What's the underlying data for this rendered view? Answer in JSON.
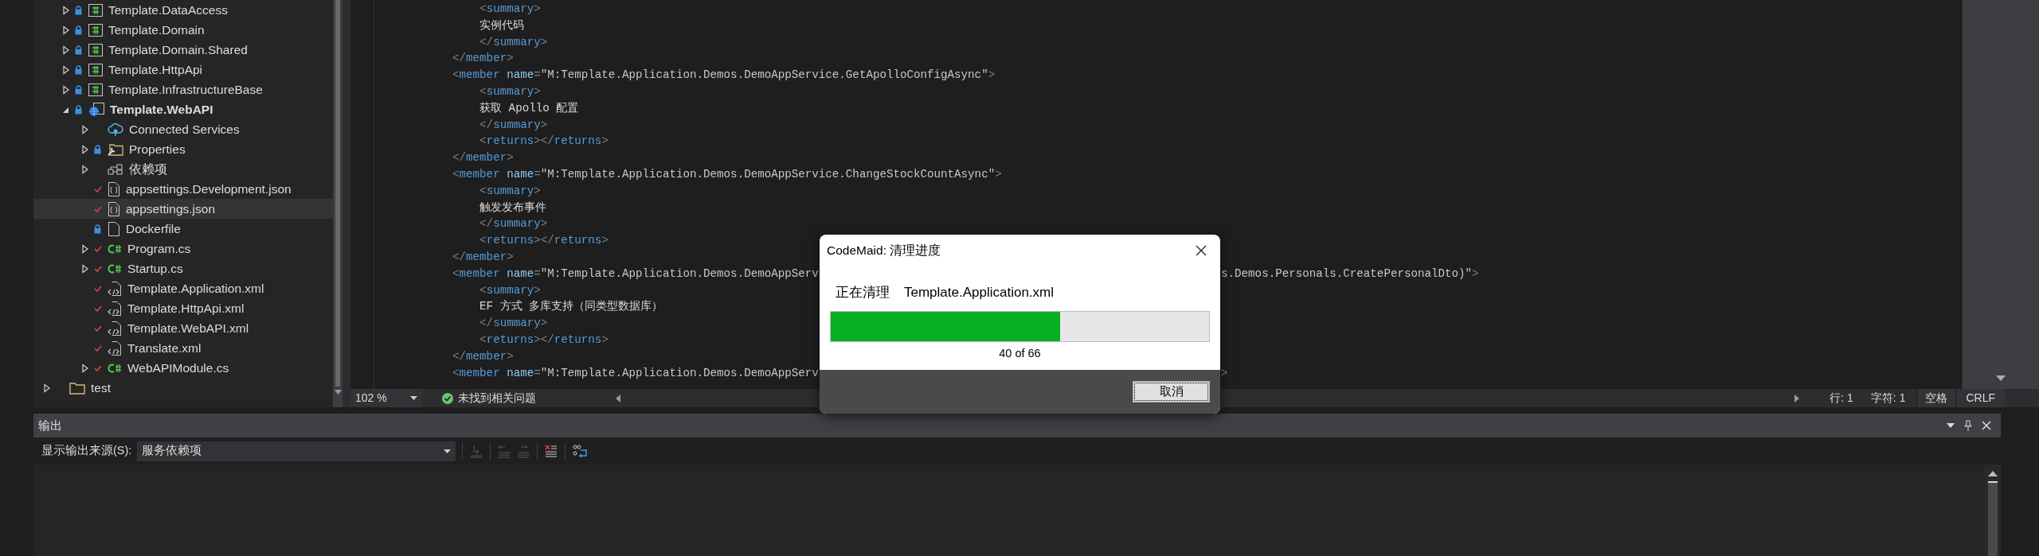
{
  "solution_explorer": {
    "projects": [
      {
        "kind": "csproj",
        "label": "Template.DataAccess",
        "expanded": false,
        "locked": true,
        "modified": false,
        "startup": false,
        "selected": false
      },
      {
        "kind": "csproj",
        "label": "Template.Domain",
        "expanded": false,
        "locked": true,
        "modified": false,
        "startup": false,
        "selected": false
      },
      {
        "kind": "csproj",
        "label": "Template.Domain.Shared",
        "expanded": false,
        "locked": true,
        "modified": false,
        "startup": false,
        "selected": false
      },
      {
        "kind": "csproj",
        "label": "Template.HttpApi",
        "expanded": false,
        "locked": true,
        "modified": false,
        "startup": false,
        "selected": false
      },
      {
        "kind": "csproj",
        "label": "Template.InfrastructureBase",
        "expanded": false,
        "locked": true,
        "modified": false,
        "startup": false,
        "selected": false
      },
      {
        "kind": "webproj",
        "label": "Template.WebAPI",
        "expanded": true,
        "locked": true,
        "modified": false,
        "startup": true,
        "selected": false,
        "children": [
          {
            "kind": "connected",
            "label": "Connected Services",
            "expanded": false,
            "locked": false,
            "modified": false,
            "startup": false,
            "selected": false
          },
          {
            "kind": "properties",
            "label": "Properties",
            "expanded": false,
            "locked": true,
            "modified": false,
            "startup": false,
            "selected": false
          },
          {
            "kind": "deps",
            "label": "依赖项",
            "expanded": false,
            "locked": false,
            "modified": false,
            "startup": false,
            "selected": false
          },
          {
            "kind": "json",
            "label": "appsettings.Development.json",
            "locked": false,
            "modified": true,
            "startup": false,
            "selected": false
          },
          {
            "kind": "json",
            "label": "appsettings.json",
            "locked": false,
            "modified": true,
            "startup": false,
            "selected": true
          },
          {
            "kind": "file",
            "label": "Dockerfile",
            "locked": true,
            "modified": false,
            "startup": false,
            "selected": false
          },
          {
            "kind": "cs",
            "label": "Program.cs",
            "expanded": false,
            "locked": false,
            "modified": true,
            "startup": false,
            "selected": false
          },
          {
            "kind": "cs",
            "label": "Startup.cs",
            "expanded": false,
            "locked": false,
            "modified": true,
            "startup": false,
            "selected": false
          },
          {
            "kind": "xml",
            "label": "Template.Application.xml",
            "locked": false,
            "modified": true,
            "startup": false,
            "selected": false
          },
          {
            "kind": "xml",
            "label": "Template.HttpApi.xml",
            "locked": false,
            "modified": true,
            "startup": false,
            "selected": false
          },
          {
            "kind": "xml",
            "label": "Template.WebAPI.xml",
            "locked": false,
            "modified": true,
            "startup": false,
            "selected": false
          },
          {
            "kind": "xml",
            "label": "Translate.xml",
            "locked": false,
            "modified": true,
            "startup": false,
            "selected": false
          },
          {
            "kind": "cs",
            "label": "WebAPIModule.cs",
            "expanded": false,
            "locked": false,
            "modified": true,
            "startup": false,
            "selected": false
          }
        ]
      }
    ],
    "root_items": [
      {
        "kind": "folder",
        "label": "test",
        "expanded": false,
        "locked": false,
        "modified": false,
        "startup": false,
        "selected": false
      }
    ]
  },
  "editor": {
    "lines": [
      {
        "kind": "inner",
        "tokens": [
          {
            "kind": "p",
            "text": "<"
          },
          {
            "kind": "tag",
            "text": "summary"
          },
          {
            "kind": "p",
            "text": ">"
          }
        ]
      },
      {
        "kind": "inner",
        "tokens": [
          {
            "kind": "text",
            "text": "实例代码"
          }
        ]
      },
      {
        "kind": "inner",
        "tokens": [
          {
            "kind": "p",
            "text": "</"
          },
          {
            "kind": "tag",
            "text": "summary"
          },
          {
            "kind": "p",
            "text": ">"
          }
        ]
      },
      {
        "kind": "member",
        "tokens": [
          {
            "kind": "p",
            "text": "</"
          },
          {
            "kind": "tag",
            "text": "member"
          },
          {
            "kind": "p",
            "text": ">"
          }
        ]
      },
      {
        "kind": "member",
        "tokens": [
          {
            "kind": "p",
            "text": "<"
          },
          {
            "kind": "tag",
            "text": "member"
          },
          {
            "kind": "attr",
            "text": "name"
          },
          {
            "kind": "p",
            "text": "="
          },
          {
            "kind": "str",
            "text": "\"M:Template.Application.Demos.DemoAppService.GetApolloConfigAsync\""
          },
          {
            "kind": "p",
            "text": ">"
          }
        ]
      },
      {
        "kind": "inner",
        "tokens": [
          {
            "kind": "p",
            "text": "<"
          },
          {
            "kind": "tag",
            "text": "summary"
          },
          {
            "kind": "p",
            "text": ">"
          }
        ]
      },
      {
        "kind": "inner",
        "tokens": [
          {
            "kind": "text",
            "text": "获取 Apollo 配置"
          }
        ]
      },
      {
        "kind": "inner",
        "tokens": [
          {
            "kind": "p",
            "text": "</"
          },
          {
            "kind": "tag",
            "text": "summary"
          },
          {
            "kind": "p",
            "text": ">"
          }
        ]
      },
      {
        "kind": "inner",
        "tokens": [
          {
            "kind": "p",
            "text": "<"
          },
          {
            "kind": "tag",
            "text": "returns"
          },
          {
            "kind": "p",
            "text": "></"
          },
          {
            "kind": "tag",
            "text": "returns"
          },
          {
            "kind": "p",
            "text": ">"
          }
        ]
      },
      {
        "kind": "member",
        "tokens": [
          {
            "kind": "p",
            "text": "</"
          },
          {
            "kind": "tag",
            "text": "member"
          },
          {
            "kind": "p",
            "text": ">"
          }
        ]
      },
      {
        "kind": "member",
        "tokens": [
          {
            "kind": "p",
            "text": "<"
          },
          {
            "kind": "tag",
            "text": "member"
          },
          {
            "kind": "attr",
            "text": "name"
          },
          {
            "kind": "p",
            "text": "="
          },
          {
            "kind": "str",
            "text": "\"M:Template.Application.Demos.DemoAppService.ChangeStockCountAsync\""
          },
          {
            "kind": "p",
            "text": ">"
          }
        ]
      },
      {
        "kind": "inner",
        "tokens": [
          {
            "kind": "p",
            "text": "<"
          },
          {
            "kind": "tag",
            "text": "summary"
          },
          {
            "kind": "p",
            "text": ">"
          }
        ]
      },
      {
        "kind": "inner",
        "tokens": [
          {
            "kind": "text",
            "text": "触发发布事件"
          }
        ]
      },
      {
        "kind": "inner",
        "tokens": [
          {
            "kind": "p",
            "text": "</"
          },
          {
            "kind": "tag",
            "text": "summary"
          },
          {
            "kind": "p",
            "text": ">"
          }
        ]
      },
      {
        "kind": "inner",
        "tokens": [
          {
            "kind": "p",
            "text": "<"
          },
          {
            "kind": "tag",
            "text": "returns"
          },
          {
            "kind": "p",
            "text": "></"
          },
          {
            "kind": "tag",
            "text": "returns"
          },
          {
            "kind": "p",
            "text": ">"
          }
        ]
      },
      {
        "kind": "member",
        "tokens": [
          {
            "kind": "p",
            "text": "</"
          },
          {
            "kind": "tag",
            "text": "member"
          },
          {
            "kind": "p",
            "text": ">"
          }
        ]
      },
      {
        "kind": "member",
        "tokens": [
          {
            "kind": "p",
            "text": "<"
          },
          {
            "kind": "tag",
            "text": "member"
          },
          {
            "kind": "attr",
            "text": "name"
          },
          {
            "kind": "p",
            "text": "="
          },
          {
            "kind": "str",
            "text": "\"M:Template.Application.Demos.DemoAppServ"
          }
        ],
        "right": [
          {
            "kind": "str",
            "text": "s.Demos.Personals.CreatePersonalDto)\""
          },
          {
            "kind": "p",
            "text": ">"
          }
        ]
      },
      {
        "kind": "inner",
        "tokens": [
          {
            "kind": "p",
            "text": "<"
          },
          {
            "kind": "tag",
            "text": "summary"
          },
          {
            "kind": "p",
            "text": ">"
          }
        ]
      },
      {
        "kind": "inner",
        "tokens": [
          {
            "kind": "text",
            "text": "EF 方式 多库支持（同类型数据库）"
          }
        ]
      },
      {
        "kind": "inner",
        "tokens": [
          {
            "kind": "p",
            "text": "</"
          },
          {
            "kind": "tag",
            "text": "summary"
          },
          {
            "kind": "p",
            "text": ">"
          }
        ]
      },
      {
        "kind": "inner",
        "tokens": [
          {
            "kind": "p",
            "text": "<"
          },
          {
            "kind": "tag",
            "text": "returns"
          },
          {
            "kind": "p",
            "text": "></"
          },
          {
            "kind": "tag",
            "text": "returns"
          },
          {
            "kind": "p",
            "text": ">"
          }
        ]
      },
      {
        "kind": "member",
        "tokens": [
          {
            "kind": "p",
            "text": "</"
          },
          {
            "kind": "tag",
            "text": "member"
          },
          {
            "kind": "p",
            "text": ">"
          }
        ]
      },
      {
        "kind": "member",
        "tokens": [
          {
            "kind": "p",
            "text": "<"
          },
          {
            "kind": "tag",
            "text": "member"
          },
          {
            "kind": "attr",
            "text": "name"
          },
          {
            "kind": "p",
            "text": "="
          },
          {
            "kind": "str",
            "text": "\"M:Template.Application.Demos.DemoAppServ"
          }
        ],
        "right": [
          {
            "kind": "p",
            "text": ">"
          }
        ]
      }
    ],
    "status_bar": {
      "zoom": "102 %",
      "issues": "未找到相关问题",
      "line": "行: 1",
      "char": "字符: 1",
      "indent": "空格",
      "eol": "CRLF"
    }
  },
  "dialog": {
    "title": "CodeMaid: 清理进度",
    "status_label": "正在清理",
    "current_file": "Template.Application.xml",
    "progress": {
      "level": 0.606
    },
    "count": "40 of 66",
    "cancel_button": "取消"
  },
  "output": {
    "title": "输出",
    "source_label": "显示输出来源(S):",
    "source_value": "服务依赖项",
    "toolbar": [
      {
        "kind": "goto",
        "disabled": true
      },
      {
        "kind": "prev",
        "disabled": true
      },
      {
        "kind": "next",
        "disabled": true
      },
      {
        "kind": "clear",
        "disabled": false
      },
      {
        "kind": "wrap",
        "disabled": false
      }
    ]
  }
}
